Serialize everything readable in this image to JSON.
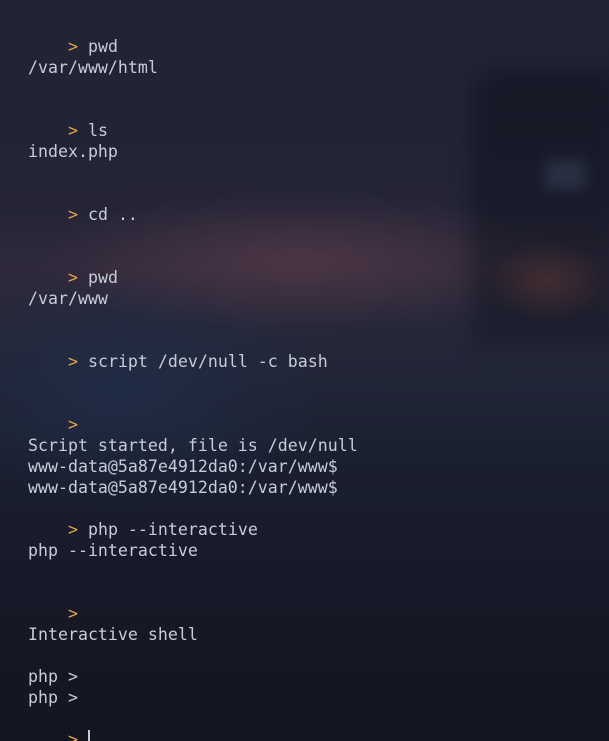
{
  "terminal": {
    "prompt_symbol": ">",
    "lines": [
      {
        "type": "cmd",
        "text": "pwd"
      },
      {
        "type": "out",
        "text": "/var/www/html"
      },
      {
        "type": "cmd",
        "text": "ls"
      },
      {
        "type": "out",
        "text": "index.php"
      },
      {
        "type": "cmd",
        "text": "cd .."
      },
      {
        "type": "cmd",
        "text": "pwd"
      },
      {
        "type": "out",
        "text": "/var/www"
      },
      {
        "type": "cmd",
        "text": "script /dev/null -c bash"
      },
      {
        "type": "cmd",
        "text": ""
      },
      {
        "type": "out",
        "text": "Script started, file is /dev/null"
      },
      {
        "type": "out",
        "text": "www-data@5a87e4912da0:/var/www$"
      },
      {
        "type": "out",
        "text": "www-data@5a87e4912da0:/var/www$"
      },
      {
        "type": "cmd",
        "text": "php --interactive"
      },
      {
        "type": "out",
        "text": "php --interactive"
      },
      {
        "type": "cmd",
        "text": ""
      },
      {
        "type": "out",
        "text": "Interactive shell"
      },
      {
        "type": "out",
        "text": "php >"
      },
      {
        "type": "out",
        "text": "php >"
      },
      {
        "type": "input",
        "text": ""
      }
    ]
  },
  "colors": {
    "prompt": "#e9a24e",
    "text": "#c8ccd8",
    "background": "#1e2233"
  }
}
